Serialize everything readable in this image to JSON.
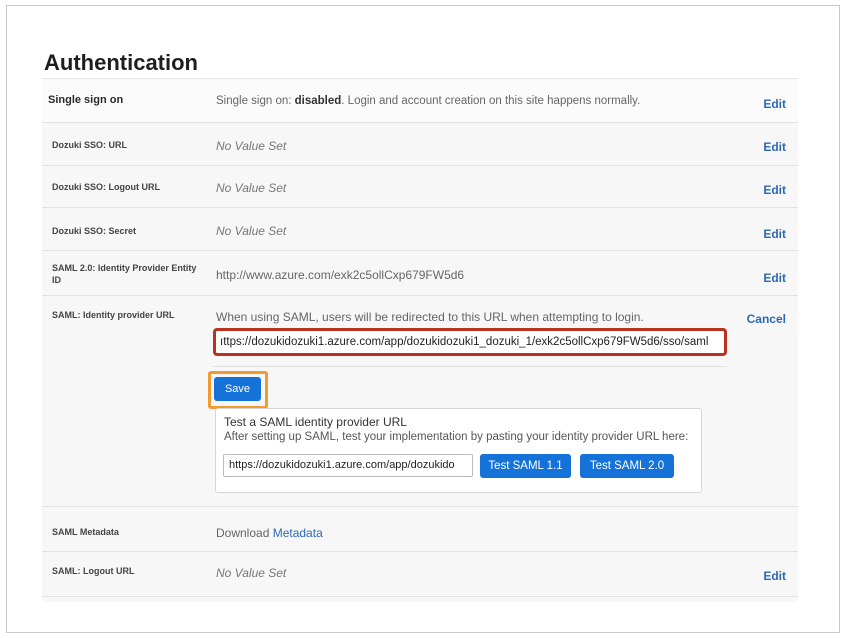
{
  "page": {
    "title": "Authentication"
  },
  "rows": {
    "sso": {
      "label": "Single sign on",
      "prefix": "Single sign on: ",
      "status": "disabled",
      "suffix": ". Login and account creation on this site happens normally.",
      "action": "Edit"
    },
    "sso_url": {
      "label": "Dozuki SSO: URL",
      "value": "No Value Set",
      "action": "Edit"
    },
    "sso_logout": {
      "label": "Dozuki SSO: Logout URL",
      "value": "No Value Set",
      "action": "Edit"
    },
    "sso_secret": {
      "label": "Dozuki SSO: Secret",
      "value": "No Value Set",
      "action": "Edit"
    },
    "saml_entity": {
      "label": "SAML 2.0: Identity Provider Entity ID",
      "value": "http://www.azure.com/exk2c5ollCxp679FW5d6",
      "action": "Edit"
    },
    "saml_idp": {
      "label": "SAML: Identity provider URL",
      "description": "When using SAML, users will be redirected to this URL when attempting to login.",
      "input_value": "ıttps://dozukidozuki1.azure.com/app/dozukidozuki1_dozuki_1/exk2c5ollCxp679FW5d6/sso/saml",
      "save_label": "Save",
      "action": "Cancel",
      "test": {
        "title": "Test a SAML identity provider URL",
        "description": "After setting up SAML, test your implementation by pasting your identity provider URL here:",
        "input_value": "https://dozukidozuki1.azure.com/app/dozukido",
        "btn_saml11": "Test SAML 1.1",
        "btn_saml20": "Test SAML 2.0"
      }
    },
    "saml_metadata": {
      "label": "SAML Metadata",
      "prefix": "Download ",
      "link": "Metadata"
    },
    "saml_logout": {
      "label": "SAML: Logout URL",
      "value": "No Value Set",
      "action": "Edit"
    }
  },
  "colors": {
    "accent": "#1572d8",
    "link": "#2d6ab4",
    "highlight_red": "#b8321f",
    "highlight_orange": "#f29a2e"
  }
}
